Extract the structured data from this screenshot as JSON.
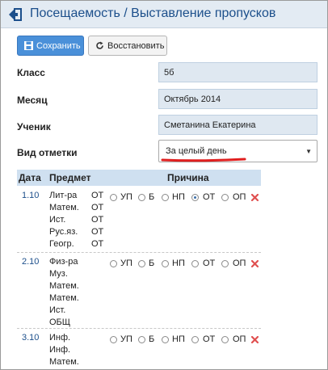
{
  "header": {
    "title": "Посещаемость / Выставление пропусков",
    "back_icon": "back-arrow-icon"
  },
  "toolbar": {
    "save_label": "Сохранить",
    "restore_label": "Восстановить"
  },
  "form": {
    "class_label": "Класс",
    "class_value": "5б",
    "month_label": "Месяц",
    "month_value": "Октябрь 2014",
    "student_label": "Ученик",
    "student_value": "Сметанина Екатерина",
    "mark_type_label": "Вид отметки",
    "mark_type_value": "За целый день"
  },
  "colors": {
    "accent": "#4a90d9",
    "header_bg": "#e3ebf3",
    "delete": "#e05050",
    "underline": "#e01f1f"
  },
  "table": {
    "columns": [
      "Дата",
      "Предмет",
      "Причина"
    ],
    "reasons": [
      "УП",
      "Б",
      "НП",
      "ОТ",
      "ОП"
    ],
    "rows": [
      {
        "date": "1.10",
        "subjects": [
          {
            "name": "Лит-ра",
            "mark": "ОТ"
          },
          {
            "name": "Матем.",
            "mark": "ОТ"
          },
          {
            "name": "Ист.",
            "mark": "ОТ"
          },
          {
            "name": "Рус.яз.",
            "mark": "ОТ"
          },
          {
            "name": "Геогр.",
            "mark": "ОТ"
          }
        ],
        "selected_reason": "ОТ"
      },
      {
        "date": "2.10",
        "subjects": [
          {
            "name": "Физ-ра",
            "mark": ""
          },
          {
            "name": "Муз.",
            "mark": ""
          },
          {
            "name": "Матем.",
            "mark": ""
          },
          {
            "name": "Матем.",
            "mark": ""
          },
          {
            "name": "Ист.",
            "mark": ""
          },
          {
            "name": "ОБЩ",
            "mark": ""
          }
        ],
        "selected_reason": ""
      },
      {
        "date": "3.10",
        "subjects": [
          {
            "name": "Инф.",
            "mark": ""
          },
          {
            "name": "Инф.",
            "mark": ""
          },
          {
            "name": "Матем.",
            "mark": ""
          }
        ],
        "selected_reason": ""
      }
    ]
  }
}
